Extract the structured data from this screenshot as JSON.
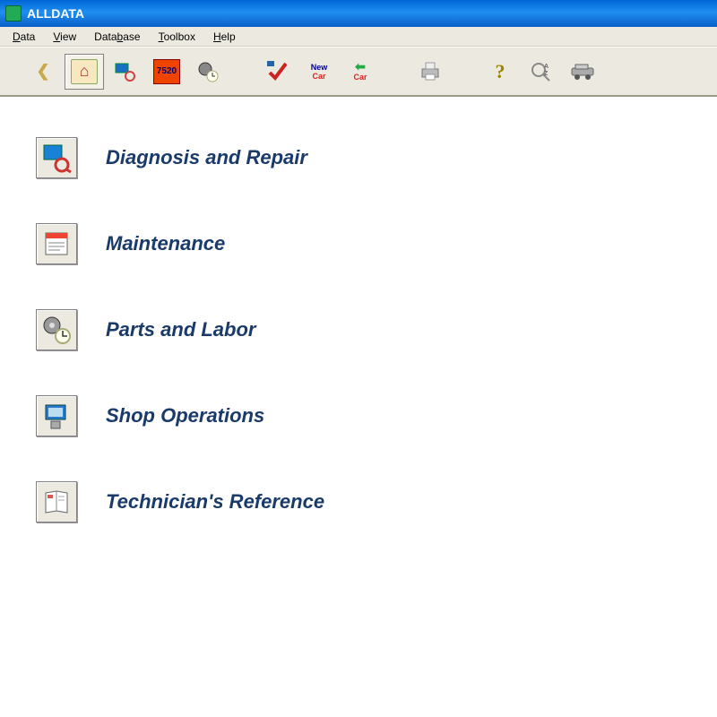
{
  "window": {
    "title": "ALLDATA"
  },
  "menu": {
    "items": [
      {
        "label": "Data",
        "accel": "D"
      },
      {
        "label": "View",
        "accel": "V"
      },
      {
        "label": "Database",
        "accel": "b"
      },
      {
        "label": "Toolbox",
        "accel": "T"
      },
      {
        "label": "Help",
        "accel": "H"
      }
    ]
  },
  "toolbar": {
    "buttons": [
      {
        "name": "back-icon"
      },
      {
        "name": "home-icon",
        "active": true
      },
      {
        "name": "wrench-magnify-icon"
      },
      {
        "name": "code-7520-icon"
      },
      {
        "name": "gear-clock-icon"
      },
      {
        "name": "spacer"
      },
      {
        "name": "checkmark-tool-icon"
      },
      {
        "name": "new-car-icon",
        "text_top": "New",
        "text_bottom": "Car"
      },
      {
        "name": "prev-car-icon",
        "text_bottom": "Car"
      },
      {
        "name": "spacer"
      },
      {
        "name": "print-icon"
      },
      {
        "name": "spacer"
      },
      {
        "name": "help-question-icon"
      },
      {
        "name": "search-az-icon"
      },
      {
        "name": "vehicle-icon"
      }
    ]
  },
  "main": {
    "categories": [
      {
        "label": "Diagnosis and Repair",
        "icon": "diagnosis-icon"
      },
      {
        "label": "Maintenance",
        "icon": "maintenance-icon"
      },
      {
        "label": "Parts and Labor",
        "icon": "parts-labor-icon"
      },
      {
        "label": "Shop Operations",
        "icon": "shop-ops-icon"
      },
      {
        "label": "Technician's Reference",
        "icon": "tech-ref-icon"
      }
    ]
  }
}
